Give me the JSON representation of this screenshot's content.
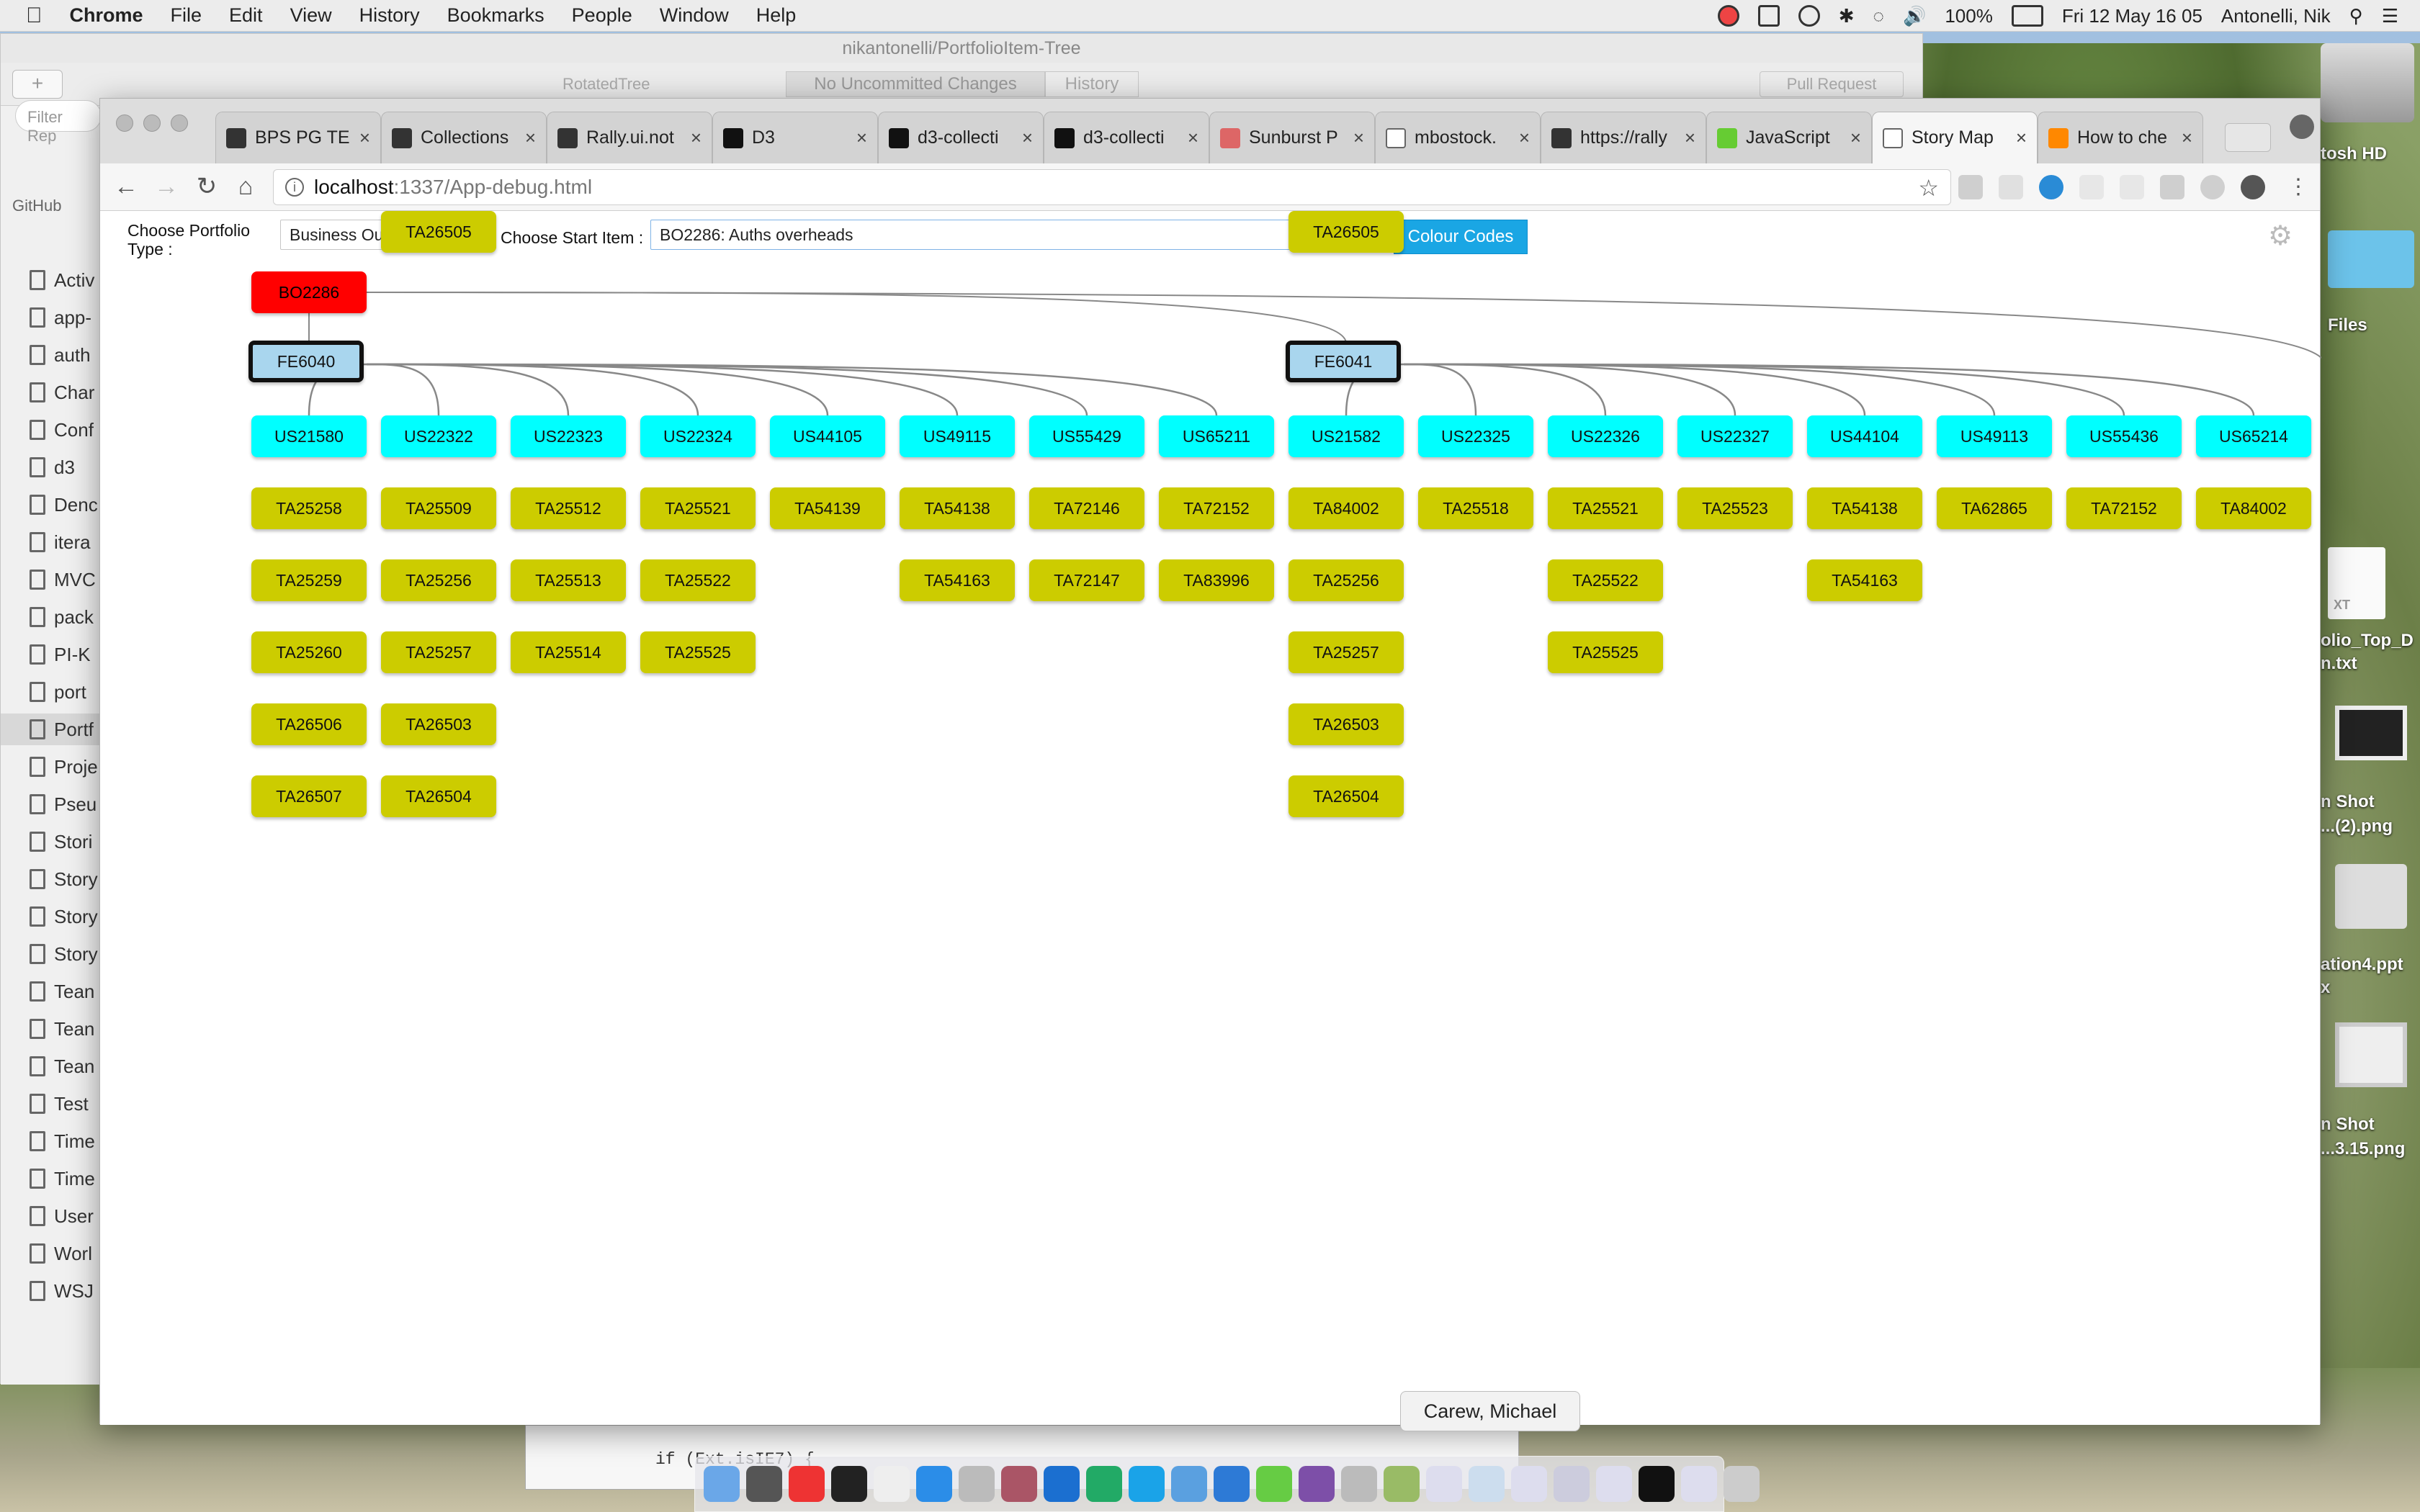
{
  "menubar": {
    "items": [
      "Chrome",
      "File",
      "Edit",
      "View",
      "History",
      "Bookmarks",
      "People",
      "Window",
      "Help"
    ],
    "battery": "100%",
    "datetime": "Fri 12 May  16 05",
    "user": "Antonelli, Nik"
  },
  "github_window": {
    "title": "nikantonelli/PortfolioItem-Tree",
    "branch": "RotatedTree",
    "changes_tab": "No Uncommitted Changes",
    "history_tab": "History",
    "pull_request": "Pull Request",
    "filter_placeholder": "Filter Rep",
    "section_label": "GitHub",
    "repos": [
      "Activ",
      "app-",
      "auth",
      "Char",
      "Conf",
      "d3",
      "Denc",
      "itera",
      "MVC",
      "pack",
      "PI-K",
      "port",
      "Portf",
      "Proje",
      "Pseu",
      "Stori",
      "Story",
      "Story",
      "Story",
      "Tean",
      "Tean",
      "Tean",
      "Test",
      "Time",
      "Time",
      "User",
      "Worl",
      "WSJ"
    ],
    "code_line": "if (Ext.isIE7) {"
  },
  "browser": {
    "tabs": [
      {
        "label": "BPS PG TE",
        "icon": "ca"
      },
      {
        "label": "Collections",
        "icon": "ca"
      },
      {
        "label": "Rally.ui.not",
        "icon": "ca"
      },
      {
        "label": "D3",
        "icon": "gh"
      },
      {
        "label": "d3-collecti",
        "icon": "gh"
      },
      {
        "label": "d3-collecti",
        "icon": "gh"
      },
      {
        "label": "Sunburst P",
        "icon": "sb"
      },
      {
        "label": "mbostock.",
        "icon": "doc"
      },
      {
        "label": "https://rally",
        "icon": "ca"
      },
      {
        "label": "JavaScript",
        "icon": "js"
      },
      {
        "label": "Story Map",
        "icon": "doc",
        "active": true
      },
      {
        "label": "How to che",
        "icon": "so"
      }
    ],
    "url_host": "localhost",
    "url_path": ":1337/App-debug.html"
  },
  "app": {
    "portfolio_type_label": "Choose Portfolio Type :",
    "portfolio_type_value": "Business Outcome",
    "start_item_label": "Choose Start Item :",
    "start_item_value": "BO2286: Auths overheads",
    "colour_codes_button": "Colour Codes"
  },
  "tree": {
    "root": "BO2286",
    "features": [
      "FE6040",
      "FE6041"
    ],
    "stories": [
      {
        "id": "US21580",
        "feature": 0,
        "tasks": [
          "TA25258",
          "TA25259",
          "TA25260",
          "TA26506",
          "TA26507"
        ]
      },
      {
        "id": "US22322",
        "feature": 0,
        "tasks": [
          "TA25509",
          "TA25256",
          "TA25257",
          "TA26503",
          "TA26504",
          "TA26505"
        ]
      },
      {
        "id": "US22323",
        "feature": 0,
        "tasks": [
          "TA25512",
          "TA25513",
          "TA25514"
        ]
      },
      {
        "id": "US22324",
        "feature": 0,
        "tasks": [
          "TA25521",
          "TA25522",
          "TA25525"
        ]
      },
      {
        "id": "US44105",
        "feature": 0,
        "tasks": [
          "TA54139"
        ]
      },
      {
        "id": "US49115",
        "feature": 0,
        "tasks": [
          "TA54138",
          "TA54163"
        ]
      },
      {
        "id": "US55429",
        "feature": 0,
        "tasks": [
          "TA72146",
          "TA72147"
        ]
      },
      {
        "id": "US65211",
        "feature": 0,
        "tasks": [
          "TA72152",
          "TA83996"
        ]
      },
      {
        "id": "US21582",
        "feature": 1,
        "tasks": [
          "TA84002",
          "TA25256",
          "TA25257",
          "TA26503",
          "TA26504",
          "TA26505"
        ]
      },
      {
        "id": "US22325",
        "feature": 1,
        "tasks": [
          "TA25518"
        ]
      },
      {
        "id": "US22326",
        "feature": 1,
        "tasks": [
          "TA25521",
          "TA25522",
          "TA25525"
        ]
      },
      {
        "id": "US22327",
        "feature": 1,
        "tasks": [
          "TA25523"
        ]
      },
      {
        "id": "US44104",
        "feature": 1,
        "tasks": [
          "TA54138",
          "TA54163"
        ]
      },
      {
        "id": "US49113",
        "feature": 1,
        "tasks": [
          "TA62865"
        ]
      },
      {
        "id": "US55436",
        "feature": 1,
        "tasks": [
          "TA72152"
        ]
      },
      {
        "id": "US65214",
        "feature": 1,
        "tasks": [
          "TA84002"
        ]
      }
    ],
    "colors": {
      "bo": "#ff0000",
      "fe": "#a9d6ee",
      "us": "#00ffff",
      "ta": "#cccc00"
    }
  },
  "desktop": {
    "labels": [
      "tosh HD",
      "Files",
      "XT",
      "olio_Top_D",
      "n.txt",
      "n Shot",
      "...(2).png",
      "ation4.ppt",
      "x",
      "n Shot",
      "...3.15.png"
    ]
  },
  "tooltip": "Carew, Michael"
}
